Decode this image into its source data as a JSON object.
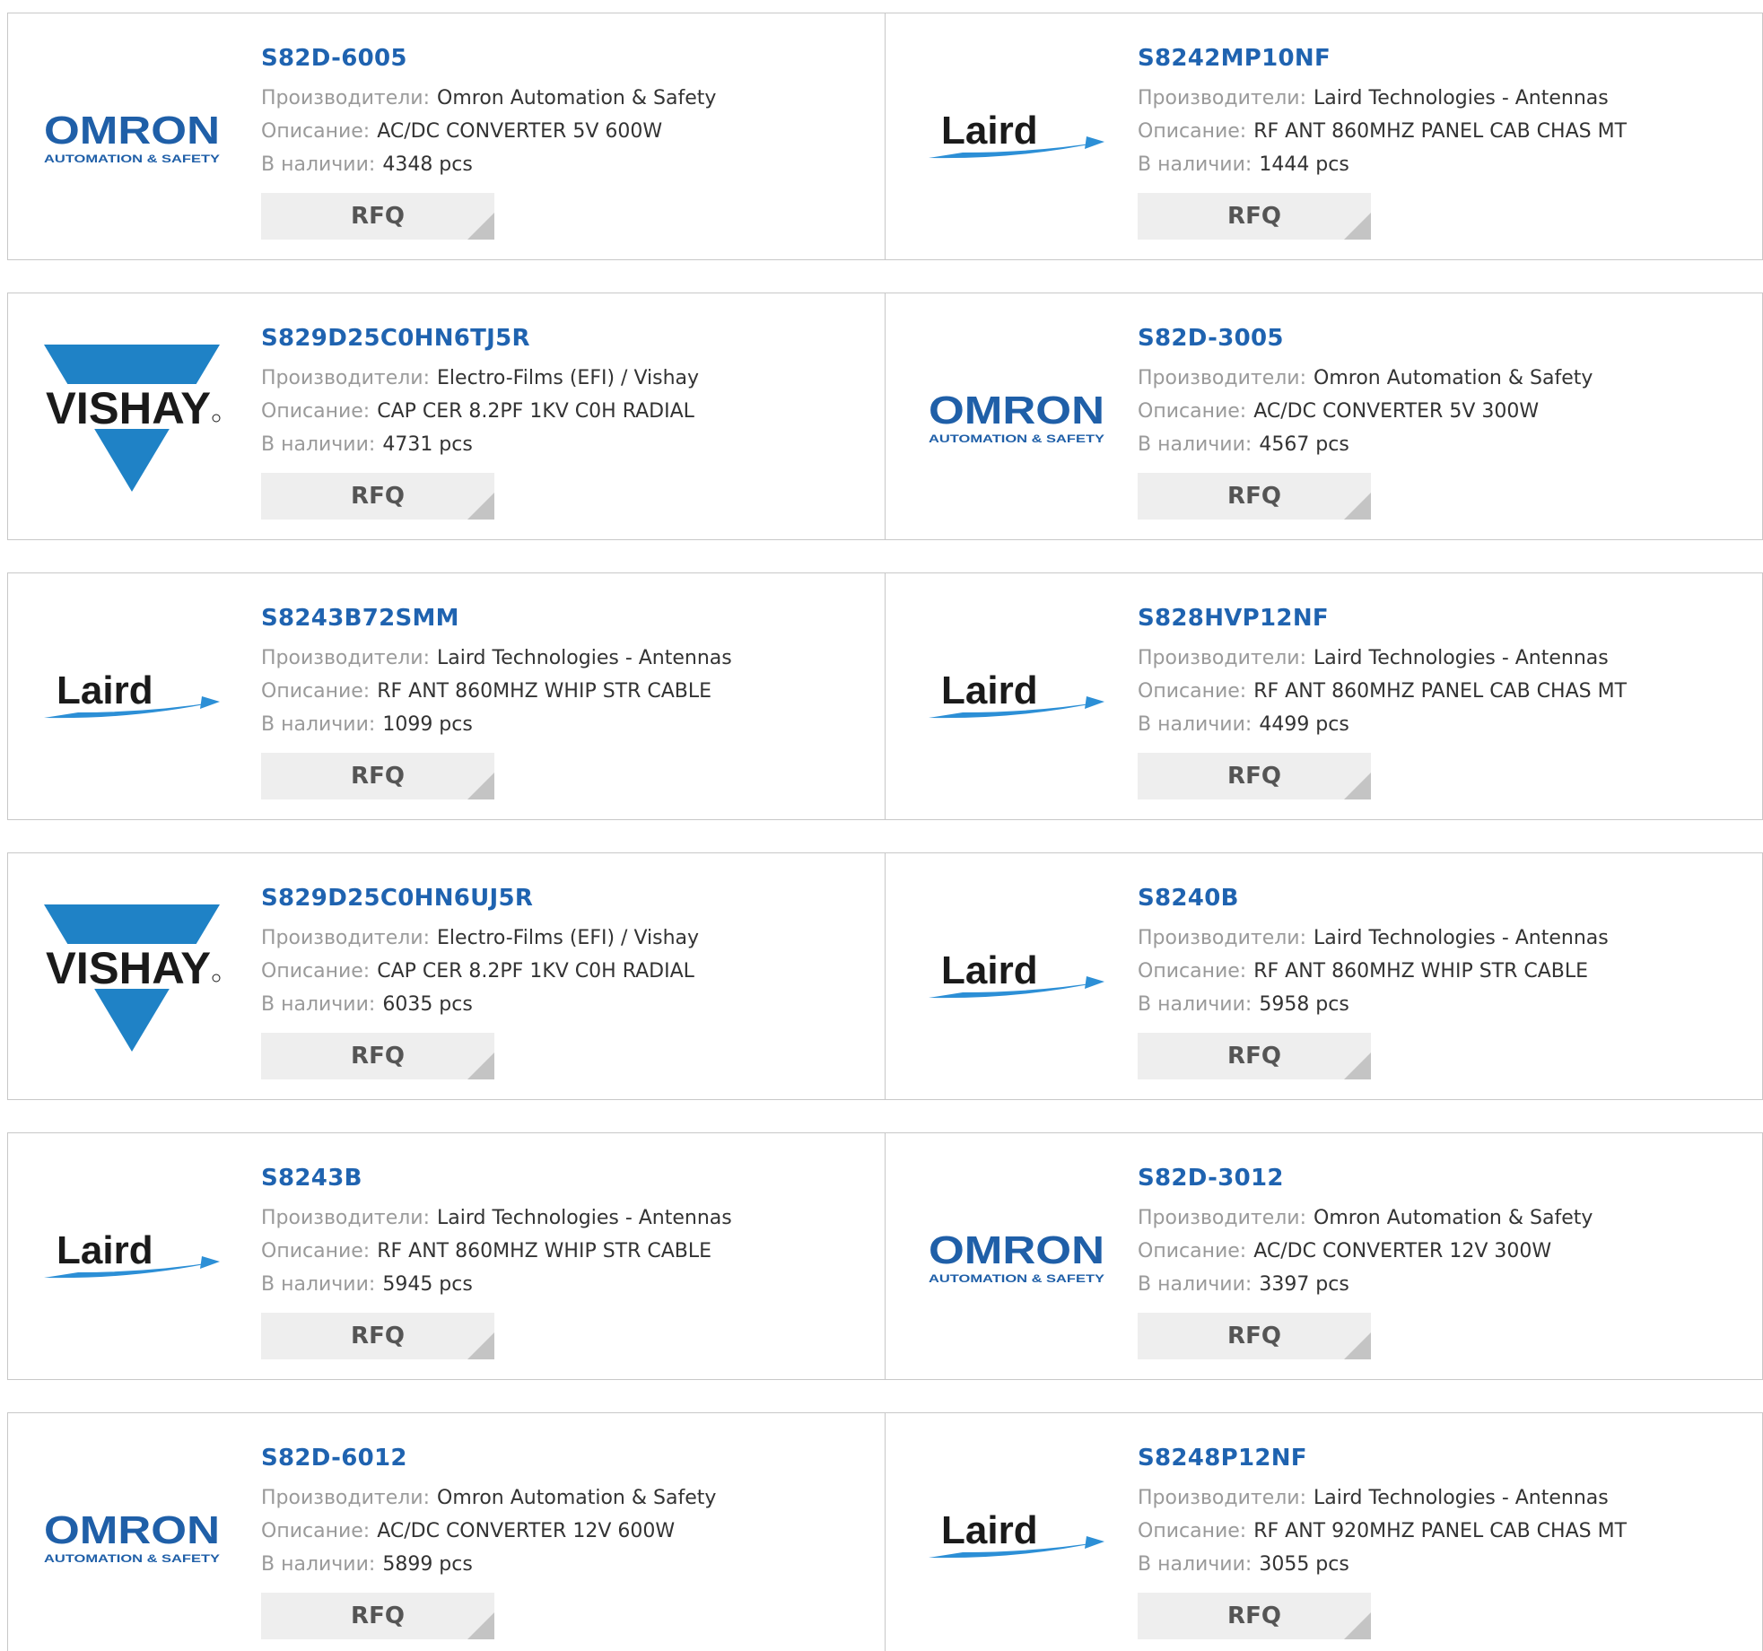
{
  "labels": {
    "manufacturer": "Производители:",
    "description": "Описание:",
    "stock": "В наличии:",
    "rfq": "RFQ"
  },
  "logos": {
    "omron": {
      "text": "OMRON",
      "tagline": "AUTOMATION & SAFETY",
      "color": "#1f5fa8"
    },
    "laird": {
      "text": "Laird",
      "color": "#1a1a1a",
      "swoosh": "#2c8fd6"
    },
    "vishay": {
      "text": "VISHAY",
      "color": "#1f82c6"
    }
  },
  "products": [
    {
      "part": "S82D-6005",
      "logo": "omron",
      "manufacturer": "Omron Automation & Safety",
      "description": "AC/DC CONVERTER 5V 600W",
      "stock": "4348 pcs"
    },
    {
      "part": "S8242MP10NF",
      "logo": "laird",
      "manufacturer": "Laird Technologies - Antennas",
      "description": "RF ANT 860MHZ PANEL CAB CHAS MT",
      "stock": "1444 pcs"
    },
    {
      "part": "S829D25C0HN6TJ5R",
      "logo": "vishay",
      "manufacturer": "Electro-Films (EFI) / Vishay",
      "description": "CAP CER 8.2PF 1KV C0H RADIAL",
      "stock": "4731 pcs"
    },
    {
      "part": "S82D-3005",
      "logo": "omron",
      "manufacturer": "Omron Automation & Safety",
      "description": "AC/DC CONVERTER 5V 300W",
      "stock": "4567 pcs"
    },
    {
      "part": "S8243B72SMM",
      "logo": "laird",
      "manufacturer": "Laird Technologies - Antennas",
      "description": "RF ANT 860MHZ WHIP STR CABLE",
      "stock": "1099 pcs"
    },
    {
      "part": "S828HVP12NF",
      "logo": "laird",
      "manufacturer": "Laird Technologies - Antennas",
      "description": "RF ANT 860MHZ PANEL CAB CHAS MT",
      "stock": "4499 pcs"
    },
    {
      "part": "S829D25C0HN6UJ5R",
      "logo": "vishay",
      "manufacturer": "Electro-Films (EFI) / Vishay",
      "description": "CAP CER 8.2PF 1KV C0H RADIAL",
      "stock": "6035 pcs"
    },
    {
      "part": "S8240B",
      "logo": "laird",
      "manufacturer": "Laird Technologies - Antennas",
      "description": "RF ANT 860MHZ WHIP STR CABLE",
      "stock": "5958 pcs"
    },
    {
      "part": "S8243B",
      "logo": "laird",
      "manufacturer": "Laird Technologies - Antennas",
      "description": "RF ANT 860MHZ WHIP STR CABLE",
      "stock": "5945 pcs"
    },
    {
      "part": "S82D-3012",
      "logo": "omron",
      "manufacturer": "Omron Automation & Safety",
      "description": "AC/DC CONVERTER 12V 300W",
      "stock": "3397 pcs"
    },
    {
      "part": "S82D-6012",
      "logo": "omron",
      "manufacturer": "Omron Automation & Safety",
      "description": "AC/DC CONVERTER 12V 600W",
      "stock": "5899 pcs"
    },
    {
      "part": "S8248P12NF",
      "logo": "laird",
      "manufacturer": "Laird Technologies - Antennas",
      "description": "RF ANT 920MHZ PANEL CAB CHAS MT",
      "stock": "3055 pcs"
    }
  ]
}
